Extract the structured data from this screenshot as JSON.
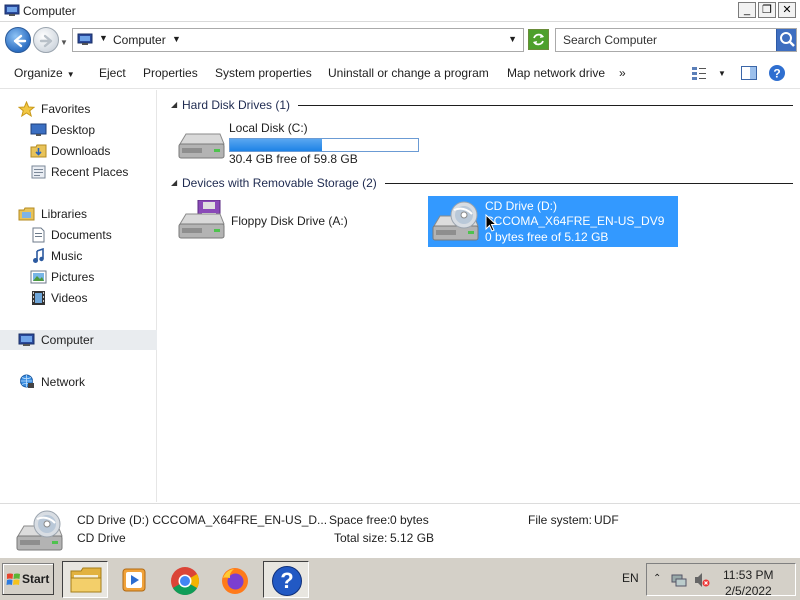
{
  "window": {
    "title": "Computer",
    "minimize_label": "_",
    "maximize_label": "❐",
    "close_label": "✕"
  },
  "address": {
    "crumb": "Computer",
    "search_placeholder": "Search Computer"
  },
  "toolbar": {
    "organize": "Organize",
    "eject": "Eject",
    "properties": "Properties",
    "system_properties": "System properties",
    "uninstall": "Uninstall or change a program",
    "map_network_drive": "Map network drive",
    "more": "»"
  },
  "nav": {
    "favorites": "Favorites",
    "desktop": "Desktop",
    "downloads": "Downloads",
    "recent_places": "Recent Places",
    "libraries": "Libraries",
    "documents": "Documents",
    "music": "Music",
    "pictures": "Pictures",
    "videos": "Videos",
    "computer": "Computer",
    "network": "Network"
  },
  "content": {
    "hdd_group": "Hard Disk Drives (1)",
    "removable_group": "Devices with Removable Storage (2)",
    "local_disk": {
      "name": "Local Disk (C:)",
      "free_text": "30.4 GB free of 59.8 GB",
      "used_fraction": 0.49
    },
    "floppy": {
      "name": "Floppy Disk Drive (A:)"
    },
    "cd_drive": {
      "name": "CD Drive (D:)",
      "label": "CCCOMA_X64FRE_EN-US_DV9",
      "free_text": "0 bytes free of 5.12 GB"
    }
  },
  "details": {
    "title": "CD Drive (D:) CCCOMA_X64FRE_EN-US_D...",
    "type": "CD Drive",
    "space_free_label": "Space free:",
    "space_free_value": "0 bytes",
    "total_size_label": "Total size:",
    "total_size_value": "5.12 GB",
    "file_system_label": "File system:",
    "file_system_value": "UDF"
  },
  "taskbar": {
    "start": "Start",
    "lang": "EN",
    "time": "11:53 PM",
    "date": "2/5/2022"
  },
  "colors": {
    "selection": "#3399ff",
    "bar_fill": "#1e82e6",
    "taskbar": "#d4d0c8"
  }
}
